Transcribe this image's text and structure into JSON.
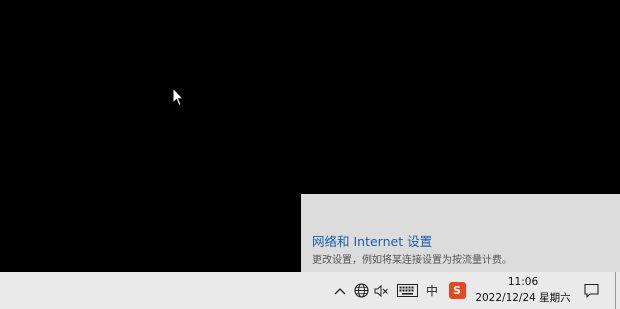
{
  "flyout": {
    "title": "网络和 Internet 设置",
    "description": "更改设置，例如将某连接设置为按流量计费。"
  },
  "tray": {
    "icons": [
      "chevron-up-icon",
      "network-globe-icon",
      "speaker-muted-icon",
      "keyboard-icon",
      "ime-chinese-icon",
      "sogou-input-icon",
      "notification-icon"
    ],
    "ime_label": "中",
    "sogou_label": "S",
    "sogou_color": "#e8461f"
  },
  "clock": {
    "time": "11:06",
    "date": "2022/12/24 星期六"
  },
  "colors": {
    "desktop": "#000000",
    "taskbar": "#eaeaea",
    "flyout": "#dcdcdc",
    "link": "#1a5ea8"
  }
}
